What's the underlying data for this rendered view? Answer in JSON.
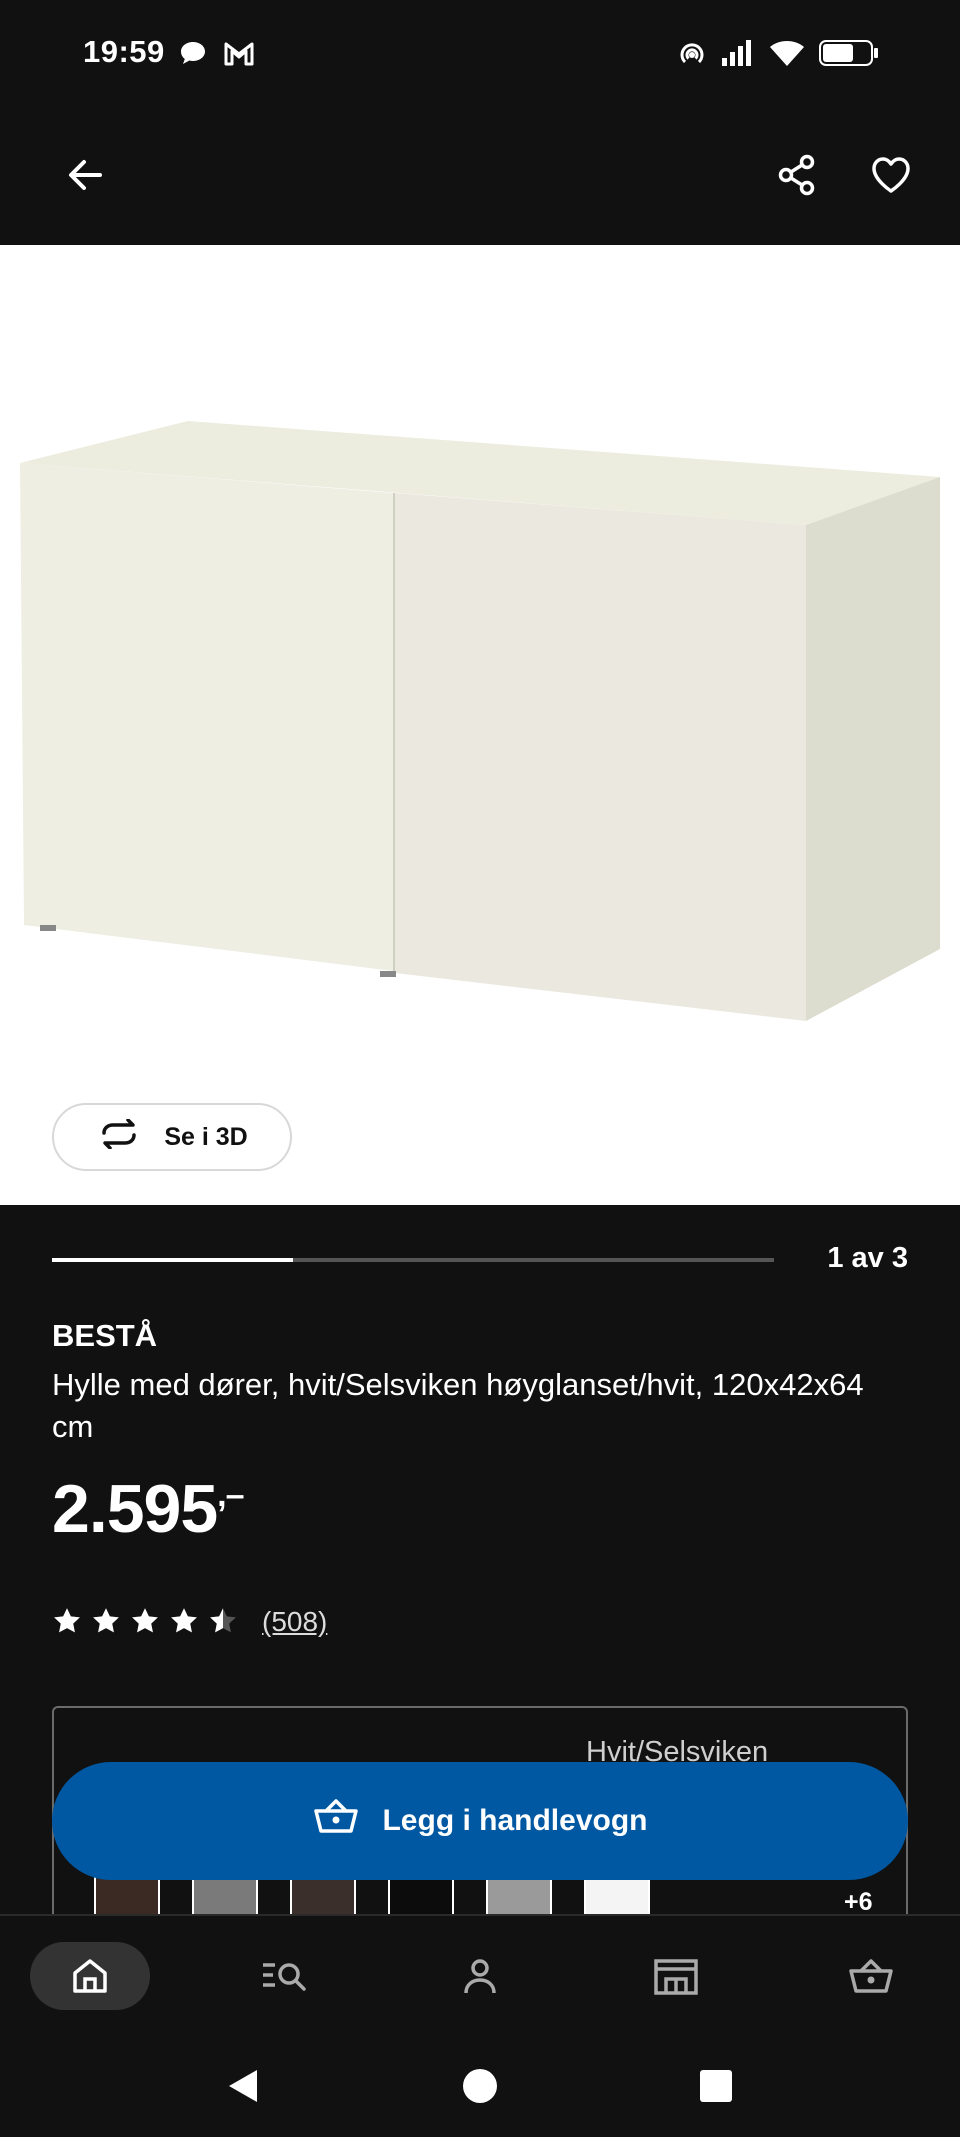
{
  "status_bar": {
    "time": "19:59",
    "icons": [
      "chat-bubble-icon",
      "gmail-icon",
      "hotspot-icon",
      "signal-icon",
      "wifi-icon",
      "battery-icon"
    ]
  },
  "header": {
    "back_icon": "arrow-left-icon",
    "share_icon": "share-icon",
    "favorite_icon": "heart-icon"
  },
  "gallery": {
    "see_3d_label": "Se i 3D",
    "progress_text": "1 av 3",
    "current": 1,
    "total": 3
  },
  "product": {
    "name": "BESTÅ",
    "description": "Hylle med dører, hvit/Selsviken høyglanset/hvit, 120x42x64 cm",
    "price": "2.595",
    "price_suffix": ",–",
    "rating": 4.5,
    "rating_max": 5,
    "review_count": "(508)"
  },
  "variants": {
    "selected_label": "Hvit/Selsviken",
    "swatch_colors": [
      "#3b2a24",
      "#7a7a7a",
      "#3a2f2b",
      "#0c0c0c",
      "#9a9a9a",
      "#f4f4f4"
    ],
    "more_label": "+6"
  },
  "cta": {
    "label": "Legg i handlevogn",
    "icon": "basket-icon",
    "color": "#0058a3"
  },
  "bottom_nav": {
    "items": [
      "home-icon",
      "search-list-icon",
      "profile-icon",
      "store-icon",
      "basket-icon"
    ],
    "active": "home-icon"
  },
  "system_nav": {
    "items": [
      "back-triangle-icon",
      "home-circle-icon",
      "recents-square-icon"
    ]
  }
}
